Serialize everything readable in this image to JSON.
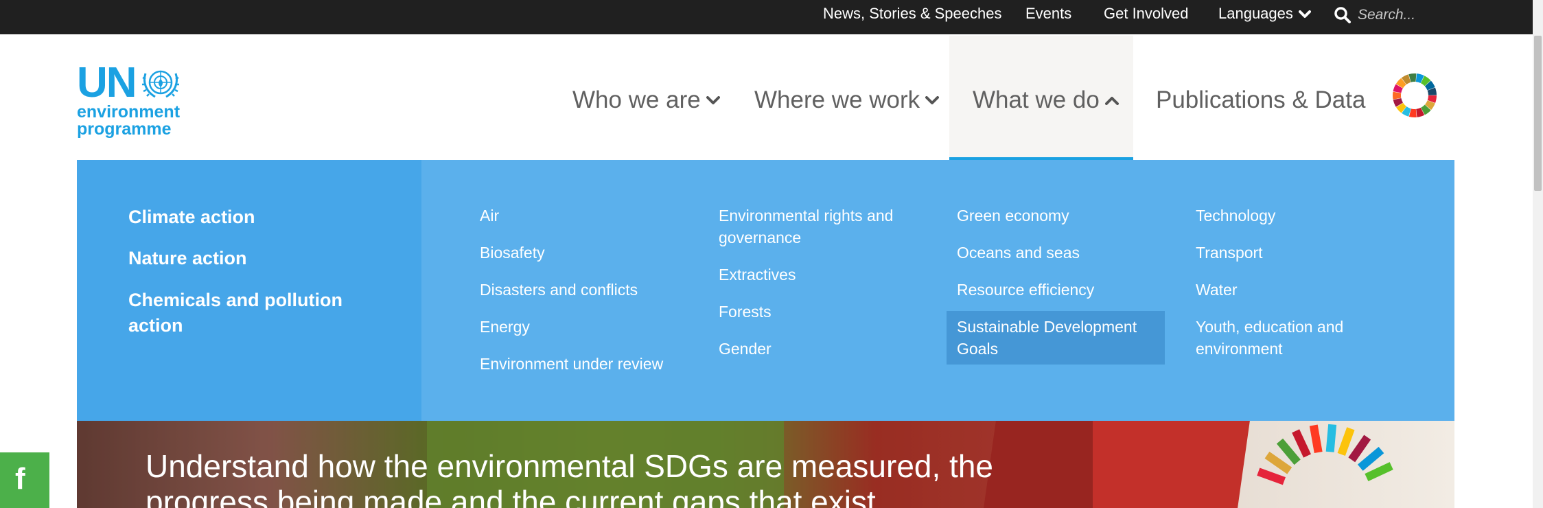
{
  "top_bar": {
    "links": [
      {
        "label": "News, Stories & Speeches"
      },
      {
        "label": "Events"
      },
      {
        "label": "Get Involved"
      },
      {
        "label": "Languages"
      }
    ],
    "search": {
      "placeholder": "Search..."
    }
  },
  "logo": {
    "mark": "UN",
    "line1": "environment",
    "line2": "programme"
  },
  "main_nav": [
    {
      "label": "Who we are",
      "expanded": false
    },
    {
      "label": "Where we work",
      "expanded": false
    },
    {
      "label": "What we do",
      "expanded": true
    },
    {
      "label": "Publications & Data"
    }
  ],
  "mega_menu": {
    "lead_links": [
      {
        "label": "Climate action"
      },
      {
        "label": "Nature action"
      },
      {
        "label": "Chemicals and pollution action"
      }
    ],
    "columns": [
      [
        {
          "label": "Air"
        },
        {
          "label": "Biosafety"
        },
        {
          "label": "Disasters and conflicts"
        },
        {
          "label": "Energy"
        },
        {
          "label": "Environment under review"
        }
      ],
      [
        {
          "label": "Environmental rights and governance"
        },
        {
          "label": "Extractives"
        },
        {
          "label": "Forests"
        },
        {
          "label": "Gender"
        }
      ],
      [
        {
          "label": "Green economy"
        },
        {
          "label": "Oceans and seas"
        },
        {
          "label": "Resource efficiency"
        },
        {
          "label": "Sustainable Development Goals",
          "highlighted": true
        }
      ],
      [
        {
          "label": "Technology"
        },
        {
          "label": "Transport"
        },
        {
          "label": "Water"
        },
        {
          "label": "Youth, education and environment"
        }
      ]
    ]
  },
  "hero": {
    "text": "Understand how the environmental SDGs are measured, the progress being made and the current gaps that exist"
  },
  "share": {
    "facebook_glyph": "f"
  },
  "colors": {
    "top_bar": "#202020",
    "brand_blue": "#1ba1e2",
    "mega_menu": "#5bb0ec",
    "mega_menu_left": "#46a6e9",
    "highlight": "#4597d6",
    "facebook": "#4cb04a"
  }
}
